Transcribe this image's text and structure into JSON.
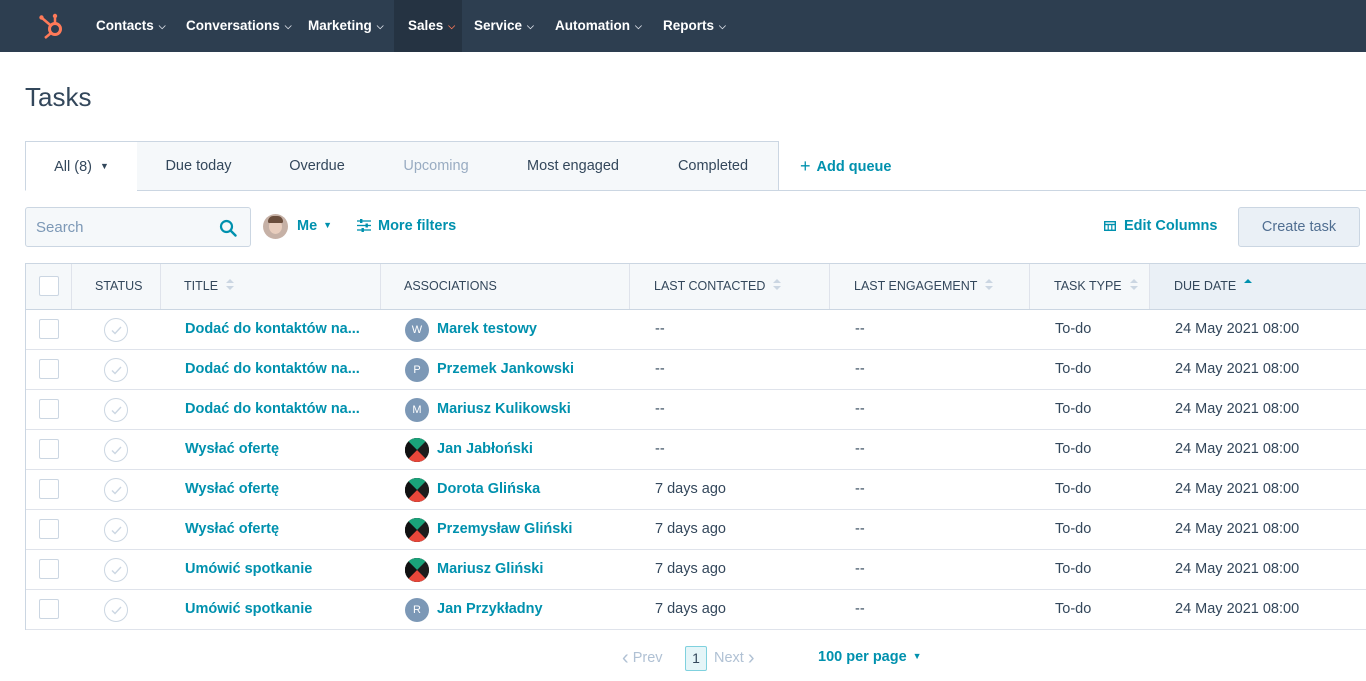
{
  "nav": {
    "items": [
      {
        "label": "Contacts"
      },
      {
        "label": "Conversations"
      },
      {
        "label": "Marketing"
      },
      {
        "label": "Sales"
      },
      {
        "label": "Service"
      },
      {
        "label": "Automation"
      },
      {
        "label": "Reports"
      }
    ],
    "active": "Sales",
    "accent_color": "#ff7a59"
  },
  "page_title": "Tasks",
  "tabs": [
    {
      "label": "All (8)"
    },
    {
      "label": "Due today"
    },
    {
      "label": "Overdue"
    },
    {
      "label": "Upcoming"
    },
    {
      "label": "Most engaged"
    },
    {
      "label": "Completed"
    }
  ],
  "add_queue_label": "Add queue",
  "search": {
    "placeholder": "Search",
    "value": ""
  },
  "owner_filter": "Me",
  "more_filters_label": "More filters",
  "edit_columns_label": "Edit Columns",
  "create_task_label": "Create task",
  "table": {
    "columns": [
      "Status",
      "Title",
      "Associations",
      "Last contacted",
      "Last engagement",
      "Task type",
      "Due date"
    ],
    "sorted_column": "Due date",
    "rows": [
      {
        "title": "Dodać do kontaktów na...",
        "avatar": "W",
        "avatar_type": "letter",
        "association": "Marek testowy",
        "last_contacted": "--",
        "last_engagement": "--",
        "task_type": "To-do",
        "due_date": "24 May 2021 08:00"
      },
      {
        "title": "Dodać do kontaktów na...",
        "avatar": "P",
        "avatar_type": "letter",
        "association": "Przemek Jankowski",
        "last_contacted": "--",
        "last_engagement": "--",
        "task_type": "To-do",
        "due_date": "24 May 2021 08:00"
      },
      {
        "title": "Dodać do kontaktów na...",
        "avatar": "M",
        "avatar_type": "letter",
        "association": "Mariusz Kulikowski",
        "last_contacted": "--",
        "last_engagement": "--",
        "task_type": "To-do",
        "due_date": "24 May 2021 08:00"
      },
      {
        "title": "Wysłać ofertę",
        "avatar": "",
        "avatar_type": "company-logo",
        "association": "Jan Jabłoński",
        "last_contacted": "--",
        "last_engagement": "--",
        "task_type": "To-do",
        "due_date": "24 May 2021 08:00"
      },
      {
        "title": "Wysłać ofertę",
        "avatar": "",
        "avatar_type": "company-logo",
        "association": "Dorota Glińska",
        "last_contacted": "7 days ago",
        "last_engagement": "--",
        "task_type": "To-do",
        "due_date": "24 May 2021 08:00"
      },
      {
        "title": "Wysłać ofertę",
        "avatar": "",
        "avatar_type": "company-logo",
        "association": "Przemysław Gliński",
        "last_contacted": "7 days ago",
        "last_engagement": "--",
        "task_type": "To-do",
        "due_date": "24 May 2021 08:00"
      },
      {
        "title": "Umówić spotkanie",
        "avatar": "",
        "avatar_type": "company-logo",
        "association": "Mariusz Gliński",
        "last_contacted": "7 days ago",
        "last_engagement": "--",
        "task_type": "To-do",
        "due_date": "24 May 2021 08:00"
      },
      {
        "title": "Umówić spotkanie",
        "avatar": "R",
        "avatar_type": "letter",
        "association": "Jan Przykładny",
        "last_contacted": "7 days ago",
        "last_engagement": "--",
        "task_type": "To-do",
        "due_date": "24 May 2021 08:00"
      }
    ]
  },
  "pagination": {
    "prev_label": "Prev",
    "page": "1",
    "next_label": "Next",
    "per_page_label": "100 per page"
  }
}
